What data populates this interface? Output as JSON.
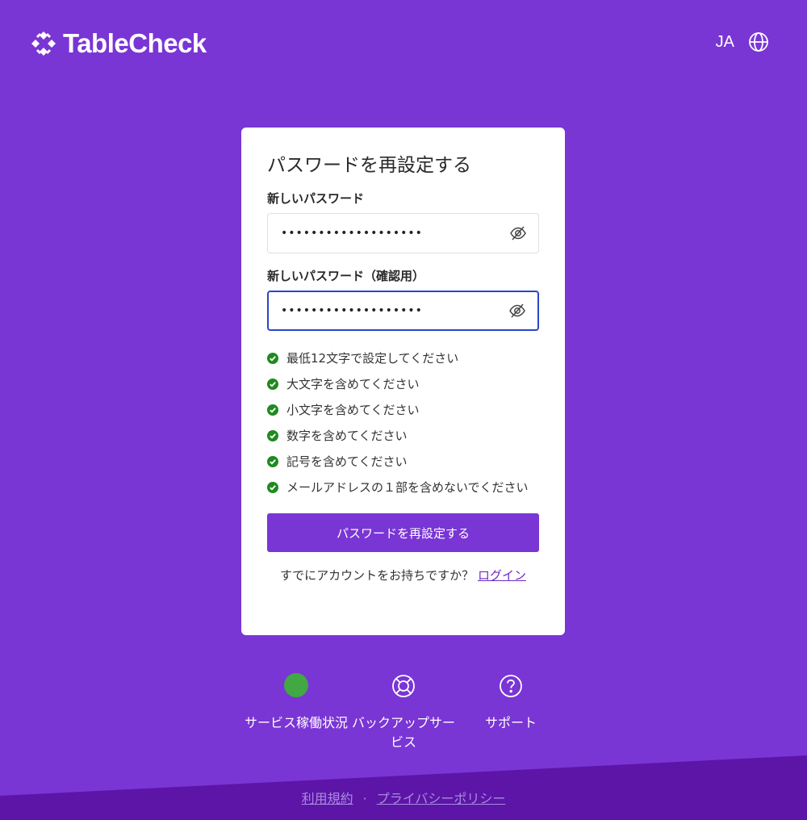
{
  "header": {
    "brand": "TableCheck",
    "language_code": "JA"
  },
  "form": {
    "title": "パスワードを再設定する",
    "new_password_label": "新しいパスワード",
    "new_password_value": "•••••••••••••••••••",
    "confirm_password_label": "新しいパスワード（確認用）",
    "confirm_password_value": "•••••••••••••••••••",
    "rules": [
      {
        "text": "最低12文字で設定してください",
        "status": "met"
      },
      {
        "text": "大文字を含めてください",
        "status": "met"
      },
      {
        "text": "小文字を含めてください",
        "status": "met"
      },
      {
        "text": "数字を含めてください",
        "status": "met"
      },
      {
        "text": "記号を含めてください",
        "status": "met"
      },
      {
        "text": "メールアドレスの１部を含めないでください",
        "status": "met"
      }
    ],
    "submit_label": "パスワードを再設定する",
    "have_account_text": "すでにアカウントをお持ちですか？",
    "login_link": "ログイン"
  },
  "footer": {
    "items": [
      {
        "label": "サービス稼働状況",
        "icon": "status-dot"
      },
      {
        "label": "バックアップサービス",
        "icon": "lifebuoy-icon"
      },
      {
        "label": "サポート",
        "icon": "help-circle-icon"
      }
    ],
    "terms_link": "利用規約",
    "separator": "·",
    "privacy_link": "プライバシーポリシー"
  },
  "colors": {
    "background": "#7a35d5",
    "footer_band": "#5d15a8",
    "primary_button": "#7a35d5",
    "check": "#1f8a1f",
    "status_ok": "#41a843",
    "focus_border": "#2a46c8"
  }
}
